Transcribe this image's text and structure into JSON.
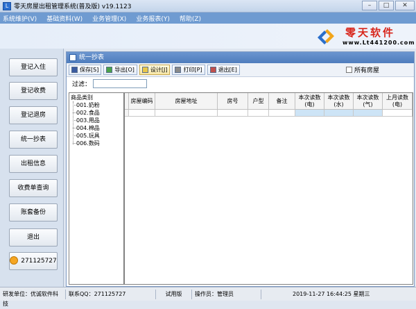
{
  "window": {
    "title": "零天房屋出租管理系统(普及版)    v19.1123",
    "min": "–",
    "max": "□",
    "close": "✕"
  },
  "menu": [
    "系统维护(V)",
    "基础资料(W)",
    "业务管理(X)",
    "业务报表(Y)",
    "帮助(Z)"
  ],
  "logo": {
    "brand": "零天软件",
    "url": "www.Lt441200.com"
  },
  "sidebar": [
    {
      "label": "登记入住"
    },
    {
      "label": "登记收费"
    },
    {
      "label": "登记退房"
    },
    {
      "label": "统一抄表"
    },
    {
      "label": "出租信息"
    },
    {
      "label": "收费单查询"
    },
    {
      "label": "账套备份"
    },
    {
      "label": "退出"
    },
    {
      "label": "271125727"
    }
  ],
  "panel": {
    "title": "统一抄表"
  },
  "toolbar": {
    "save": "保存[S]",
    "export": "导出[O]",
    "design": "设计[J]",
    "print": "打印[P]",
    "exit": "退出[E]",
    "all_houses": "所有房屋"
  },
  "filter": {
    "label": "过滤：",
    "value": ""
  },
  "tree": {
    "root": "商品类别",
    "items": [
      "001.奶粉",
      "002.食品",
      "003.用品",
      "004.棉品",
      "005.玩具",
      "006.数码"
    ]
  },
  "grid": {
    "columns": [
      "房屋编码",
      "房屋地址",
      "房号",
      "户型",
      "备注",
      "本次读数(电)",
      "本次读数(水)",
      "本次读数(气)",
      "上月读数(电)"
    ]
  },
  "status": {
    "dev": "研发单位：优诚软件科技",
    "qq": "联系QQ：271125727",
    "trial": "试用版",
    "operator": "操作员：管理员",
    "datetime": "2019-11-27  16:44:25  星期三"
  }
}
